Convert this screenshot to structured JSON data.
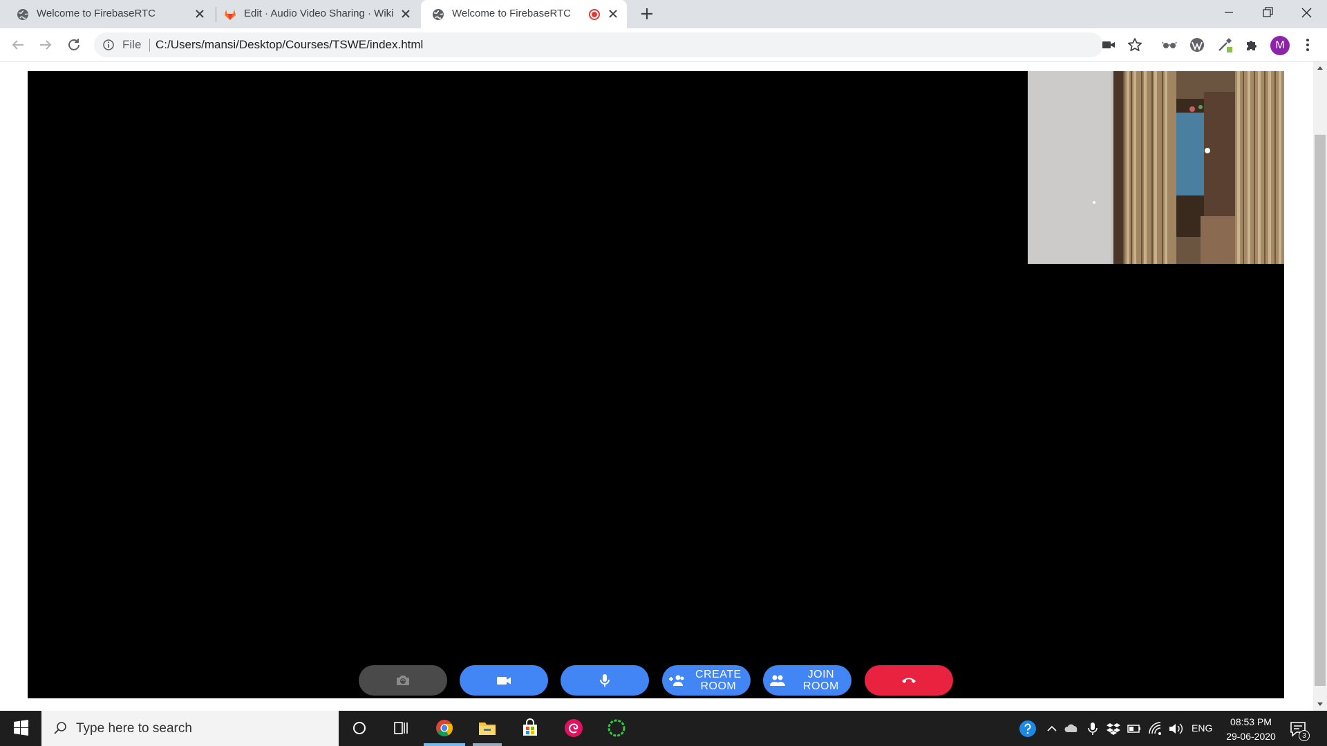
{
  "browser": {
    "tabs": [
      {
        "title": "Welcome to FirebaseRTC",
        "favicon": "globe-icon"
      },
      {
        "title": "Edit · Audio Video Sharing · Wiki",
        "favicon": "gitlab-icon"
      },
      {
        "title": "Welcome to FirebaseRTC",
        "favicon": "globe-icon",
        "recording": true
      }
    ],
    "active_tab": 2
  },
  "address_bar": {
    "scheme_label": "File",
    "url": "C:/Users/mansi/Desktop/Courses/TSWE/index.html"
  },
  "profile": {
    "initial": "M"
  },
  "controls": {
    "create_room_label_1": "CREATE",
    "create_room_label_2": "ROOM",
    "join_room_label_1": "JOIN",
    "join_room_label_2": "ROOM"
  },
  "taskbar": {
    "search_placeholder": "Type here to search",
    "language": "ENG",
    "time": "08:53 PM",
    "date": "29-06-2020",
    "notification_count": "3"
  },
  "colors": {
    "button_blue": "#4285f4",
    "button_red": "#e8223f",
    "button_gray": "#4a4a4a",
    "avatar_purple": "#8e24aa"
  }
}
